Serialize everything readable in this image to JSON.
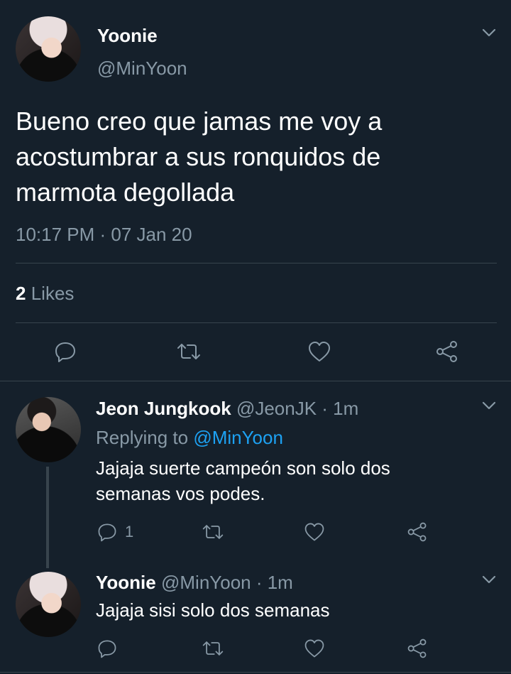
{
  "main_tweet": {
    "display_name": "Yoonie",
    "handle": "@MinYoon",
    "text": "Bueno creo que jamas me voy a acostumbrar a sus ronquidos de marmota degollada",
    "timestamp": "10:17 PM · 07 Jan 20",
    "likes_count": "2",
    "likes_label": "Likes"
  },
  "replies": [
    {
      "display_name": "Jeon Jungkook",
      "handle_time": "@JeonJK · 1m",
      "replying_prefix": "Replying to",
      "replying_to": "@MinYoon",
      "text_line1": "Jajaja suerte campeón son solo dos",
      "text_line2": "semanas vos podes.",
      "reply_count": "1"
    },
    {
      "display_name": "Yoonie",
      "handle_time": "@MinYoon · 1m",
      "text": "Jajaja sisi solo dos semanas"
    }
  ],
  "colors": {
    "background": "#15202b",
    "text": "#ffffff",
    "muted": "#8899a6",
    "link": "#1da1f2",
    "divider": "#38444d"
  },
  "icons": [
    "chevron-down-icon",
    "reply-icon",
    "retweet-icon",
    "like-icon",
    "share-icon"
  ]
}
